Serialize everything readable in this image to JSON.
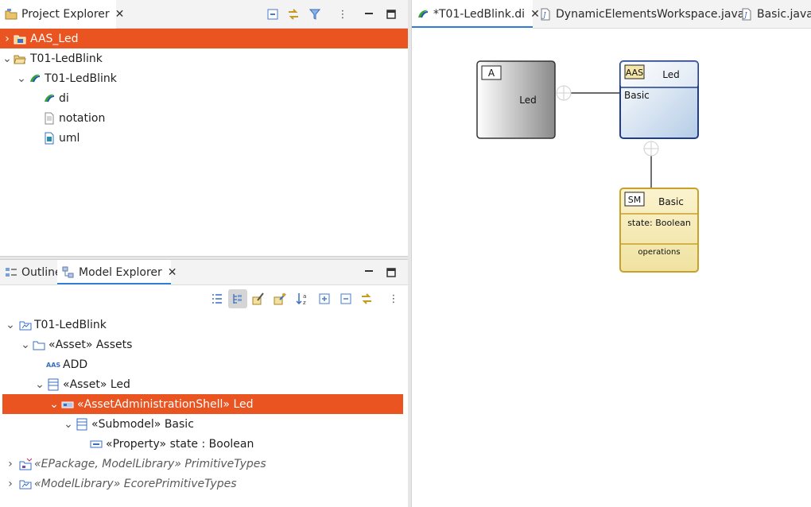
{
  "project_explorer": {
    "tab_label": "Project Explorer",
    "tree": [
      {
        "label": "AAS_Led",
        "icon": "aas-project-icon",
        "expanded": false,
        "selected": true
      },
      {
        "label": "T01-LedBlink",
        "icon": "open-folder-icon",
        "expanded": true
      },
      {
        "label": "T01-LedBlink",
        "icon": "papyrus-model-icon",
        "expanded": true
      },
      {
        "label": "di",
        "icon": "papyrus-di-icon"
      },
      {
        "label": "notation",
        "icon": "file-icon"
      },
      {
        "label": "uml",
        "icon": "uml-file-icon"
      }
    ]
  },
  "outline_tab_label": "Outline",
  "model_explorer": {
    "tab_label": "Model Explorer",
    "tree": [
      {
        "label": "T01-LedBlink",
        "expanded": true
      },
      {
        "label": "«Asset» Assets",
        "expanded": true
      },
      {
        "label": "ADD"
      },
      {
        "label": "«Asset» Led",
        "expanded": true
      },
      {
        "label": "«AssetAdministrationShell» Led",
        "expanded": true,
        "selected": true
      },
      {
        "label": "«Submodel» Basic",
        "expanded": true
      },
      {
        "label": "«Property» state : Boolean"
      },
      {
        "label": "«EPackage, ModelLibrary» PrimitiveTypes",
        "expanded": false,
        "italic": true
      },
      {
        "label": "«ModelLibrary» EcorePrimitiveTypes",
        "expanded": false,
        "italic": true
      }
    ]
  },
  "editor": {
    "tabs": [
      {
        "label": "*T01-LedBlink.di",
        "active": true
      },
      {
        "label": "DynamicElementsWorkspace.java"
      },
      {
        "label": "Basic.java"
      }
    ],
    "diagram": {
      "asset_node": {
        "tag": "A",
        "name": "Led"
      },
      "aas_node": {
        "tag": "AAS",
        "name": "Led",
        "submodel": "Basic"
      },
      "submodel_node": {
        "tag": "SM",
        "name": "Basic",
        "property": "state: Boolean",
        "operations": "operations"
      }
    }
  },
  "colors": {
    "selection": "#e95420",
    "tab_active_underline": "#2f7bd8",
    "aas_border": "#1f3d8c",
    "submodel_border": "#c8a02a"
  }
}
